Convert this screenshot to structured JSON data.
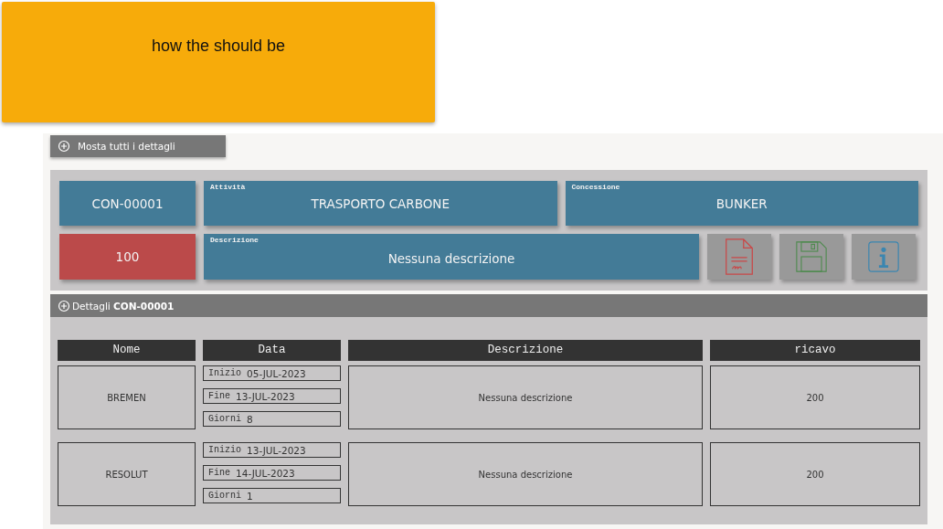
{
  "note": {
    "text": "how the should be"
  },
  "toggle_all": {
    "label": "Mosta tutti i dettagli"
  },
  "summary": {
    "code": "CON-00001",
    "activity": {
      "label": "Attività",
      "value": "TRASPORTO CARBONE"
    },
    "concession": {
      "label": "Concessione",
      "value": "BUNKER"
    },
    "amount": "100",
    "description": {
      "label": "Descrizione",
      "value": "Nessuna descrizione"
    }
  },
  "actions": [
    {
      "kind": "document"
    },
    {
      "kind": "save"
    },
    {
      "kind": "info"
    }
  ],
  "details": {
    "title": "Dettagli **CON-00001**"
  },
  "table": {
    "columns": [
      "Nome",
      "Data",
      "Descrizione",
      "ricavo"
    ],
    "rows": [
      {
        "name": "BREMEN",
        "start_label": "Inizio",
        "start": "05-JUL-2023",
        "end_label": "Fine",
        "end": "13-JUL-2023",
        "days_label": "Giorni",
        "days": "8",
        "description": "Nessuna descrizione",
        "revenue": "200"
      },
      {
        "name": "RESOLUT",
        "start_label": "Inizio",
        "start": "13-JUL-2023",
        "end_label": "Fine",
        "end": "14-JUL-2023",
        "days_label": "Giorni",
        "days": "1",
        "description": "Nessuna descrizione",
        "revenue": "200"
      }
    ]
  }
}
